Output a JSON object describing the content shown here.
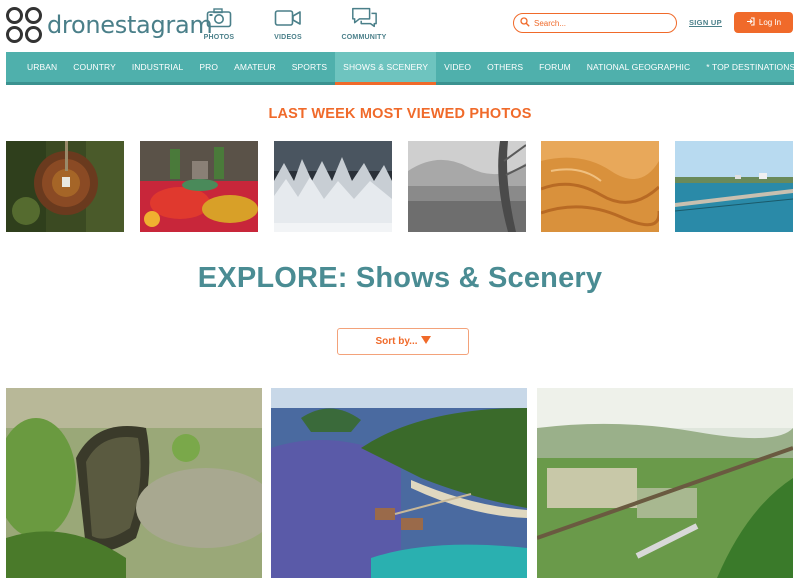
{
  "brand": {
    "name": "dronestagram"
  },
  "topnav": [
    {
      "key": "photos",
      "label": "PHOTOS",
      "icon": "camera-icon"
    },
    {
      "key": "videos",
      "label": "VIDEOS",
      "icon": "video-camera-icon"
    },
    {
      "key": "community",
      "label": "COMMUNITY",
      "icon": "chat-bubbles-icon"
    }
  ],
  "search": {
    "placeholder": "Search..."
  },
  "auth": {
    "signup_label": "SIGN UP",
    "login_label": "Log In"
  },
  "categories": [
    "URBAN",
    "COUNTRY",
    "INDUSTRIAL",
    "PRO",
    "AMATEUR",
    "SPORTS",
    "SHOWS & SCENERY",
    "VIDEO",
    "OTHERS",
    "FORUM",
    "NATIONAL GEOGRAPHIC",
    "* TOP DESTINATIONS *"
  ],
  "active_category": "SHOWS & SCENERY",
  "most_viewed": {
    "title": "LAST WEEK MOST VIEWED PHOTOS"
  },
  "explore": {
    "title": "EXPLORE: Shows & Scenery",
    "sort_label": "Sort by..."
  },
  "colors": {
    "accent": "#f06a2a",
    "teal": "#4fb0ac",
    "teal_dark": "#4a8c93"
  }
}
